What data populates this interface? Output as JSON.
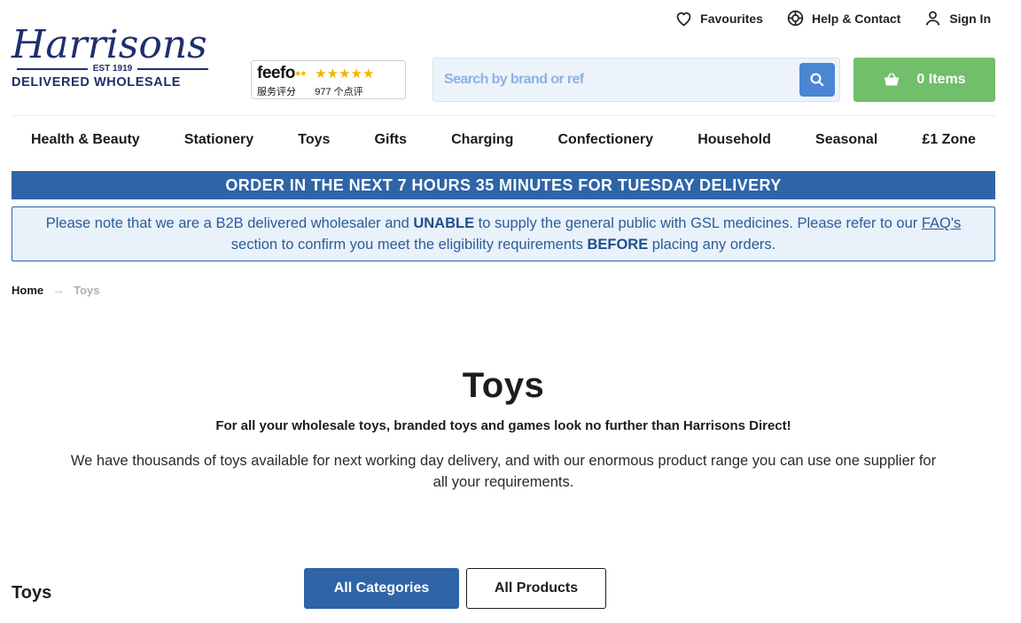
{
  "header": {
    "util_nav": [
      {
        "label": "Favourites",
        "icon": "heart-icon"
      },
      {
        "label": "Help & Contact",
        "icon": "lifebuoy-icon"
      },
      {
        "label": "Sign In",
        "icon": "user-icon"
      }
    ],
    "logo": {
      "script": "Harrisons",
      "est": "EST 1919",
      "sub": "DELIVERED WHOLESALE"
    },
    "feefo": {
      "brand": "feefo",
      "label": "服务评分",
      "stars": "★★★★★",
      "count": "977 个点评"
    },
    "search": {
      "placeholder": "Search by brand or ref",
      "value": ""
    },
    "basket": {
      "label": "0 Items"
    }
  },
  "main_nav": [
    "Health & Beauty",
    "Stationery",
    "Toys",
    "Gifts",
    "Charging",
    "Confectionery",
    "Household",
    "Seasonal",
    "£1 Zone"
  ],
  "banner": {
    "text": "ORDER IN THE NEXT 7 HOURS 35 MINUTES FOR TUESDAY DELIVERY"
  },
  "notice": {
    "part1": "Please note that we are a B2B delivered wholesaler and ",
    "bold1": "UNABLE",
    "part2": " to supply the general public with GSL medicines. Please refer to our ",
    "link": "FAQ's",
    "part3": " section to confirm you meet the eligibility requirements ",
    "bold2": "BEFORE",
    "part4": " placing any orders."
  },
  "breadcrumb": {
    "home": "Home",
    "current": "Toys"
  },
  "page": {
    "title": "Toys",
    "lead": "For all your wholesale toys, branded toys and games look no further than Harrisons Direct!",
    "intro": "We have thousands of toys available for next working day delivery, and with our enormous product range you can use one supplier for all your requirements."
  },
  "listing": {
    "section_title": "Toys",
    "tab_categories": "All Categories",
    "tab_products": "All Products"
  },
  "colors": {
    "brand_navy": "#1f2f6c",
    "primary_blue": "#2f64a6",
    "search_button": "#4a86d3",
    "basket_green": "#71bf6a",
    "notice_bg": "#e9f1fb"
  }
}
